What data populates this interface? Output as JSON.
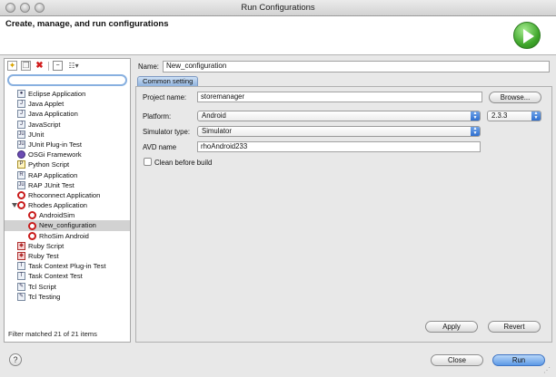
{
  "window": {
    "title": "Run Configurations"
  },
  "header": {
    "title": "Create, manage, and run configurations",
    "run_icon": "run-play-icon"
  },
  "left_panel": {
    "toolbar_icons": [
      "new-config-icon",
      "duplicate-icon",
      "delete-icon",
      "collapse-all-icon",
      "filter-icon"
    ],
    "filter_placeholder": "",
    "tree": [
      {
        "label": "Eclipse Application",
        "indent": 0,
        "icon": "eclipse-icon"
      },
      {
        "label": "Java Applet",
        "indent": 0,
        "icon": "java-applet-icon"
      },
      {
        "label": "Java Application",
        "indent": 0,
        "icon": "java-app-icon"
      },
      {
        "label": "JavaScript",
        "indent": 0,
        "icon": "javascript-icon"
      },
      {
        "label": "JUnit",
        "indent": 0,
        "icon": "junit-icon"
      },
      {
        "label": "JUnit Plug-in Test",
        "indent": 0,
        "icon": "junit-plugin-icon"
      },
      {
        "label": "OSGi Framework",
        "indent": 0,
        "icon": "osgi-icon"
      },
      {
        "label": "Python Script",
        "indent": 0,
        "icon": "python-icon"
      },
      {
        "label": "RAP Application",
        "indent": 0,
        "icon": "rap-icon"
      },
      {
        "label": "RAP JUnit Test",
        "indent": 0,
        "icon": "rap-junit-icon"
      },
      {
        "label": "Rhoconnect Application",
        "indent": 0,
        "icon": "rho-icon"
      },
      {
        "label": "Rhodes Application",
        "indent": 0,
        "icon": "rho-icon",
        "expanded": true
      },
      {
        "label": "AndroidSim",
        "indent": 1,
        "icon": "rho-icon"
      },
      {
        "label": "New_configuration",
        "indent": 1,
        "icon": "rho-icon",
        "selected": true
      },
      {
        "label": "RhoSim Android",
        "indent": 1,
        "icon": "rho-icon"
      },
      {
        "label": "Ruby Script",
        "indent": 0,
        "icon": "ruby-icon"
      },
      {
        "label": "Ruby Test",
        "indent": 0,
        "icon": "ruby-test-icon"
      },
      {
        "label": "Task Context Plug-in Test",
        "indent": 0,
        "icon": "task-plugin-icon"
      },
      {
        "label": "Task Context Test",
        "indent": 0,
        "icon": "task-test-icon"
      },
      {
        "label": "Tcl Script",
        "indent": 0,
        "icon": "tcl-icon"
      },
      {
        "label": "Tcl Testing",
        "indent": 0,
        "icon": "tcl-test-icon"
      }
    ],
    "status": "Filter matched 21 of 21 items"
  },
  "config": {
    "name_label": "Name:",
    "name_value": "New_configuration",
    "tab_label": "Common setting",
    "project_label": "Project name:",
    "project_value": "storemanager",
    "browse_label": "Browse...",
    "platform_label": "Platform:",
    "platform_value": "Android",
    "platform_version": "2.3.3",
    "simulator_label": "Simulator type:",
    "simulator_value": "Simulator",
    "avd_label": "AVD name",
    "avd_value": "rhoAndroid233",
    "clean_label": "Clean before build",
    "clean_checked": false,
    "apply_label": "Apply",
    "revert_label": "Revert"
  },
  "footer": {
    "help_icon": "?",
    "close_label": "Close",
    "run_label": "Run"
  },
  "colors": {
    "accent": "#5c99e6",
    "selection": "#d2d2d2",
    "run_green": "#3ea52a"
  }
}
